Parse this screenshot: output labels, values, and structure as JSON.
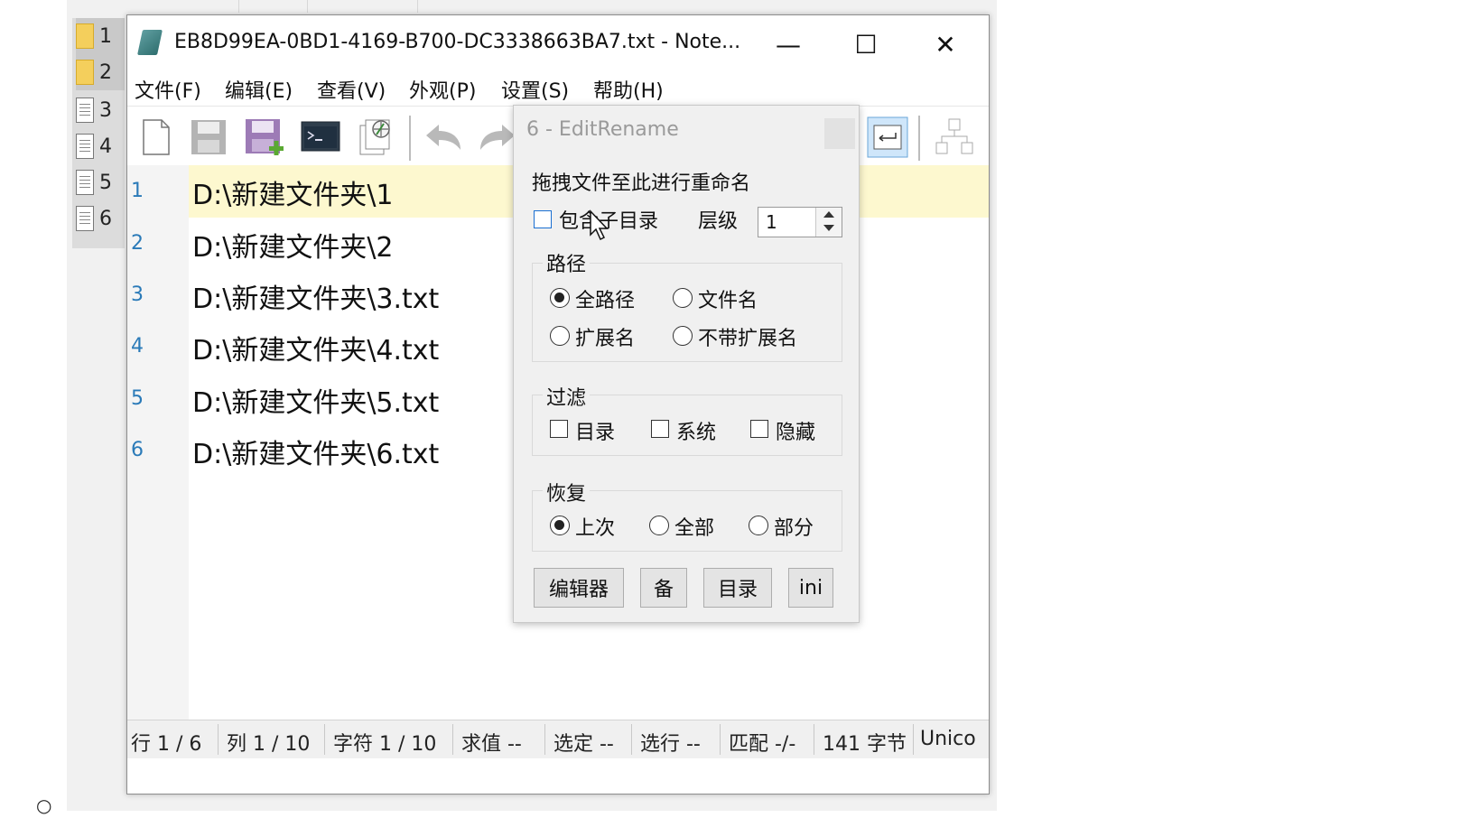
{
  "side_list": {
    "items": [
      {
        "num": "1",
        "icon": "folder-icon"
      },
      {
        "num": "2",
        "icon": "folder-icon"
      },
      {
        "num": "3",
        "icon": "document-icon"
      },
      {
        "num": "4",
        "icon": "document-icon"
      },
      {
        "num": "5",
        "icon": "document-icon"
      },
      {
        "num": "6",
        "icon": "document-icon"
      }
    ]
  },
  "window": {
    "title": "EB8D99EA-0BD1-4169-B700-DC3338663BA7.txt - Note...",
    "controls": {
      "minimize": "—",
      "maximize": "☐",
      "close": "✕"
    }
  },
  "menu": {
    "file": "文件(F)",
    "edit": "编辑(E)",
    "view": "查看(V)",
    "appearance": "外观(P)",
    "settings": "设置(S)",
    "help": "帮助(H)"
  },
  "editor": {
    "lines": [
      {
        "num": "1",
        "text": "D:\\新建文件夹\\1"
      },
      {
        "num": "2",
        "text": "D:\\新建文件夹\\2"
      },
      {
        "num": "3",
        "text": "D:\\新建文件夹\\3.txt"
      },
      {
        "num": "4",
        "text": "D:\\新建文件夹\\4.txt"
      },
      {
        "num": "5",
        "text": "D:\\新建文件夹\\5.txt"
      },
      {
        "num": "6",
        "text": "D:\\新建文件夹\\6.txt"
      }
    ]
  },
  "status": {
    "row": "行 1 / 6",
    "col": "列 1 / 10",
    "char": "字符 1 / 10",
    "eval": "求值 --",
    "sel": "选定 --",
    "sel_rows": "选行 --",
    "match": "匹配 -/-",
    "bytes": "141 字节",
    "encoding": "Unico"
  },
  "popup": {
    "title": "6 - EditRename",
    "drag_hint": "拖拽文件至此进行重命名",
    "include_subdir": "包含子目录",
    "level_label": "层级",
    "level_value": "1",
    "path_group": "路径",
    "path_full": "全路径",
    "path_filename": "文件名",
    "path_ext": "扩展名",
    "path_noext": "不带扩展名",
    "filter_group": "过滤",
    "filter_dir": "目录",
    "filter_system": "系统",
    "filter_hidden": "隐藏",
    "restore_group": "恢复",
    "restore_last": "上次",
    "restore_all": "全部",
    "restore_part": "部分",
    "btn_editor": "编辑器",
    "btn_backup": "备",
    "btn_dir": "目录",
    "btn_ini": "ini"
  },
  "page": {
    "bullet": "○"
  }
}
